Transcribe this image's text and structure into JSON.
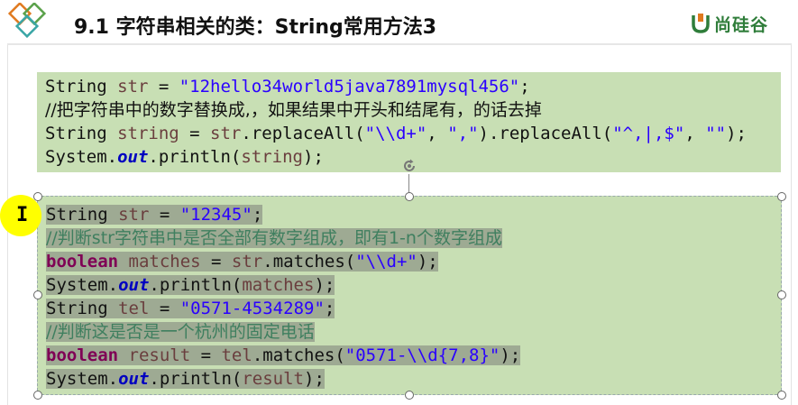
{
  "header": {
    "title": "9.1 字符串相关的类：String常用方法3",
    "brand": "尚硅谷",
    "logo_icon": "diamond-logo-icon",
    "brand_icon": "u-shield-icon",
    "accent_green": "#2f7d3a",
    "accent_orange": "#e07a1f"
  },
  "code_block_1": {
    "background": "#c8dfb4",
    "lines": [
      {
        "t1": "String ",
        "t2": "str",
        "t3": " = ",
        "t4": "\"12hello34world5java7891mysql456\"",
        "t5": ";"
      },
      {
        "comment": "//把字符串中的数字替换成,，如果结果中开头和结尾有，的话去掉"
      },
      {
        "t1": "String ",
        "t2": "string",
        "t3": " = ",
        "t4": "str",
        "t5": ".replaceAll(",
        "t6": "\"\\\\d+\"",
        "t7": ", ",
        "t8": "\",\"",
        "t9": ").replaceAll(",
        "t10": "\"^,|,$\"",
        "t11": ", ",
        "t12": "\"\"",
        "t13": ");"
      },
      {
        "t1": "System.",
        "t2": "out",
        "t3": ".println(",
        "t4": "string",
        "t5": ");"
      }
    ]
  },
  "code_block_2": {
    "background": "#c8dfb4",
    "lines": [
      {
        "t1": "String ",
        "t2": "str",
        "t3": " = ",
        "t4": "\"12345\"",
        "t5": ";"
      },
      {
        "comment": "//判断str字符串中是否全部有数字组成，即有1-n个数字组成"
      },
      {
        "t1": "boolean",
        "t2": " matches",
        "t3": " = ",
        "t4": "str",
        "t5": ".matches(",
        "t6": "\"\\\\d+\"",
        "t7": ");"
      },
      {
        "t1": "System.",
        "t2": "out",
        "t3": ".println(",
        "t4": "matches",
        "t5": ");"
      },
      {
        "t1": "String ",
        "t2": "tel",
        "t3": " = ",
        "t4": "\"0571-4534289\"",
        "t5": ";"
      },
      {
        "comment": "//判断这是否是一个杭州的固定电话"
      },
      {
        "t1": "boolean",
        "t2": " result",
        "t3": " = ",
        "t4": "tel",
        "t5": ".matches(",
        "t6": "\"0571-\\\\d{7,8}\"",
        "t7": ");"
      },
      {
        "t1": "System.",
        "t2": "out",
        "t3": ".println(",
        "t4": "result",
        "t5": ");"
      }
    ]
  },
  "cursor": {
    "icon": "text-cursor-icon",
    "highlight_color": "#ffff00"
  },
  "rotate_handle": {
    "icon": "rotate-handle-icon"
  }
}
